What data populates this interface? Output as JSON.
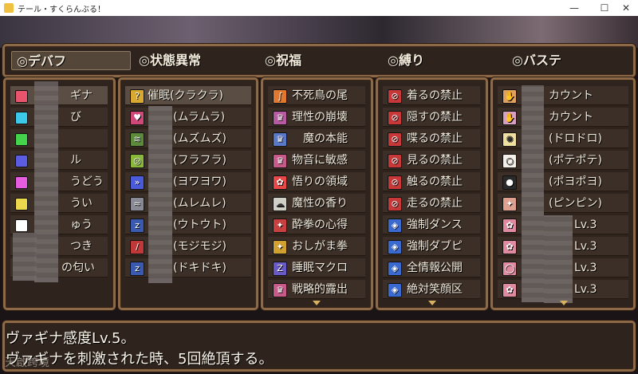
{
  "window": {
    "title": "テール・すくらんぶる！",
    "minimize": "—",
    "maximize": "☐",
    "close": "✕"
  },
  "tabs": [
    {
      "label": "◎デバフ"
    },
    {
      "label": "◎状態異常"
    },
    {
      "label": "◎祝福"
    },
    {
      "label": "◎縛り"
    },
    {
      "label": "◎バステ"
    }
  ],
  "col1": [
    {
      "label": "ギナ",
      "color": "#e8546c"
    },
    {
      "label": "び",
      "color": "#3cc8e8"
    },
    {
      "label": "",
      "color": "#44d44c"
    },
    {
      "label": "ル",
      "color": "#5c5ce0"
    },
    {
      "label": "うどう",
      "color": "#e85ce0"
    },
    {
      "label": "うい",
      "color": "#ecd84c"
    },
    {
      "label": "ゅう",
      "color": "#ffffff"
    },
    {
      "label": "つき",
      "color": "#2a2a2a"
    },
    {
      "label": "の匂い",
      "color": "#2a2a2a"
    }
  ],
  "col2": [
    {
      "label": "催眠(クラクラ)",
      "icon": "question-icon"
    },
    {
      "label": "(ムラムラ)",
      "icon": "heart-icon"
    },
    {
      "label": "(ムズムズ)",
      "icon": "lines-icon"
    },
    {
      "label": "(フラフラ)",
      "icon": "spiral-icon"
    },
    {
      "label": "(ヨワヨワ)",
      "icon": "chevron-icon"
    },
    {
      "label": "(ムレムレ)",
      "icon": "steam-icon"
    },
    {
      "label": "(ウトウト)",
      "icon": "zz-icon"
    },
    {
      "label": "(モジモジ)",
      "icon": "stripe-icon"
    },
    {
      "label": "(ドキドキ)",
      "icon": "zz-icon"
    }
  ],
  "col3": [
    {
      "label": "不死鳥の尾",
      "icon": "feather-icon"
    },
    {
      "label": "理性の崩壊",
      "icon": "crown-icon"
    },
    {
      "label": "魔の本能",
      "icon": "crown-icon"
    },
    {
      "label": "物音に敏感",
      "icon": "crown-icon"
    },
    {
      "label": "悟りの領域",
      "icon": "flower-icon"
    },
    {
      "label": "魔性の香り",
      "icon": "cloud-icon"
    },
    {
      "label": "酔拳の心得",
      "icon": "sparkle-icon"
    },
    {
      "label": "おしがま拳",
      "icon": "sparkle-icon"
    },
    {
      "label": "睡眠マクロ",
      "icon": "zz-icon"
    },
    {
      "label": "戦略的露出",
      "icon": "crown-icon"
    }
  ],
  "col4": [
    {
      "label": "着るの禁止",
      "icon": "prohibit-icon"
    },
    {
      "label": "隠すの禁止",
      "icon": "prohibit-icon"
    },
    {
      "label": "喋るの禁止",
      "icon": "prohibit-icon"
    },
    {
      "label": "見るの禁止",
      "icon": "prohibit-icon"
    },
    {
      "label": "触るの禁止",
      "icon": "prohibit-icon"
    },
    {
      "label": "走るの禁止",
      "icon": "prohibit-icon"
    },
    {
      "label": "強制ダンス",
      "icon": "blue-shield-icon"
    },
    {
      "label": "強制ダブピ",
      "icon": "blue-shield-icon"
    },
    {
      "label": "全情報公開",
      "icon": "blue-shield-icon"
    },
    {
      "label": "絶対笑顔区",
      "icon": "blue-shield-icon"
    }
  ],
  "col5": [
    {
      "label": "カウント",
      "icon": "pink-icon"
    },
    {
      "label": "カウント",
      "icon": "pink-icon"
    },
    {
      "label": "(ドロドロ)",
      "icon": "pink-icon"
    },
    {
      "label": "(ポテポテ)",
      "icon": "egg-icon"
    },
    {
      "label": "(ポヨポヨ)",
      "icon": "bomb-icon"
    },
    {
      "label": "(ピンピン)",
      "icon": "pink-icon"
    },
    {
      "label": "Lv.3",
      "icon": "pink-icon"
    },
    {
      "label": "Lv.3",
      "icon": "pink-icon"
    },
    {
      "label": "Lv.3",
      "icon": "pink-icon"
    },
    {
      "label": "Lv.3",
      "icon": "pink-icon"
    }
  ],
  "message": {
    "line1": "ヴァギナ感度Lv.5。",
    "line2": "ヴァギナを刺激された時、5回絶頂する。"
  },
  "watermark": "天啟跨境"
}
